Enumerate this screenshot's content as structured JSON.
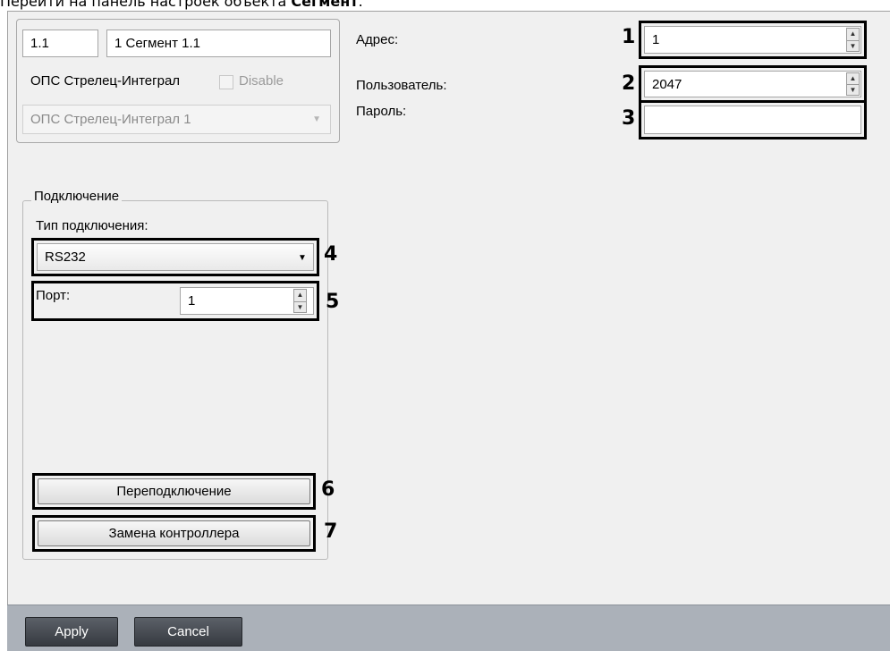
{
  "caption": {
    "prefix": "Перейти на панель настроек объекта ",
    "bold": "Сегмент",
    "suffix": "."
  },
  "object": {
    "id": "1.1",
    "name": "1 Сегмент 1.1",
    "parent_label": "ОПС Стрелец-Интеграл",
    "disable_label": "Disable",
    "parent_select": "ОПС Стрелец-Интеграл 1"
  },
  "fields": {
    "address_label": "Адрес:",
    "address_value": "1",
    "user_label": "Пользователь:",
    "user_value": "2047",
    "password_label": "Пароль:",
    "password_value": ""
  },
  "connection": {
    "group_title": "Подключение",
    "type_label": "Тип подключения:",
    "type_value": "RS232",
    "port_label": "Порт:",
    "port_value": "1",
    "reconnect_button": "Переподключение",
    "replace_button": "Замена контроллера"
  },
  "callouts": [
    "1",
    "2",
    "3",
    "4",
    "5",
    "6",
    "7"
  ],
  "footer": {
    "apply": "Apply",
    "cancel": "Cancel"
  },
  "icons": [
    "spin-up-icon",
    "spin-down-icon",
    "dropdown-arrow-icon"
  ]
}
